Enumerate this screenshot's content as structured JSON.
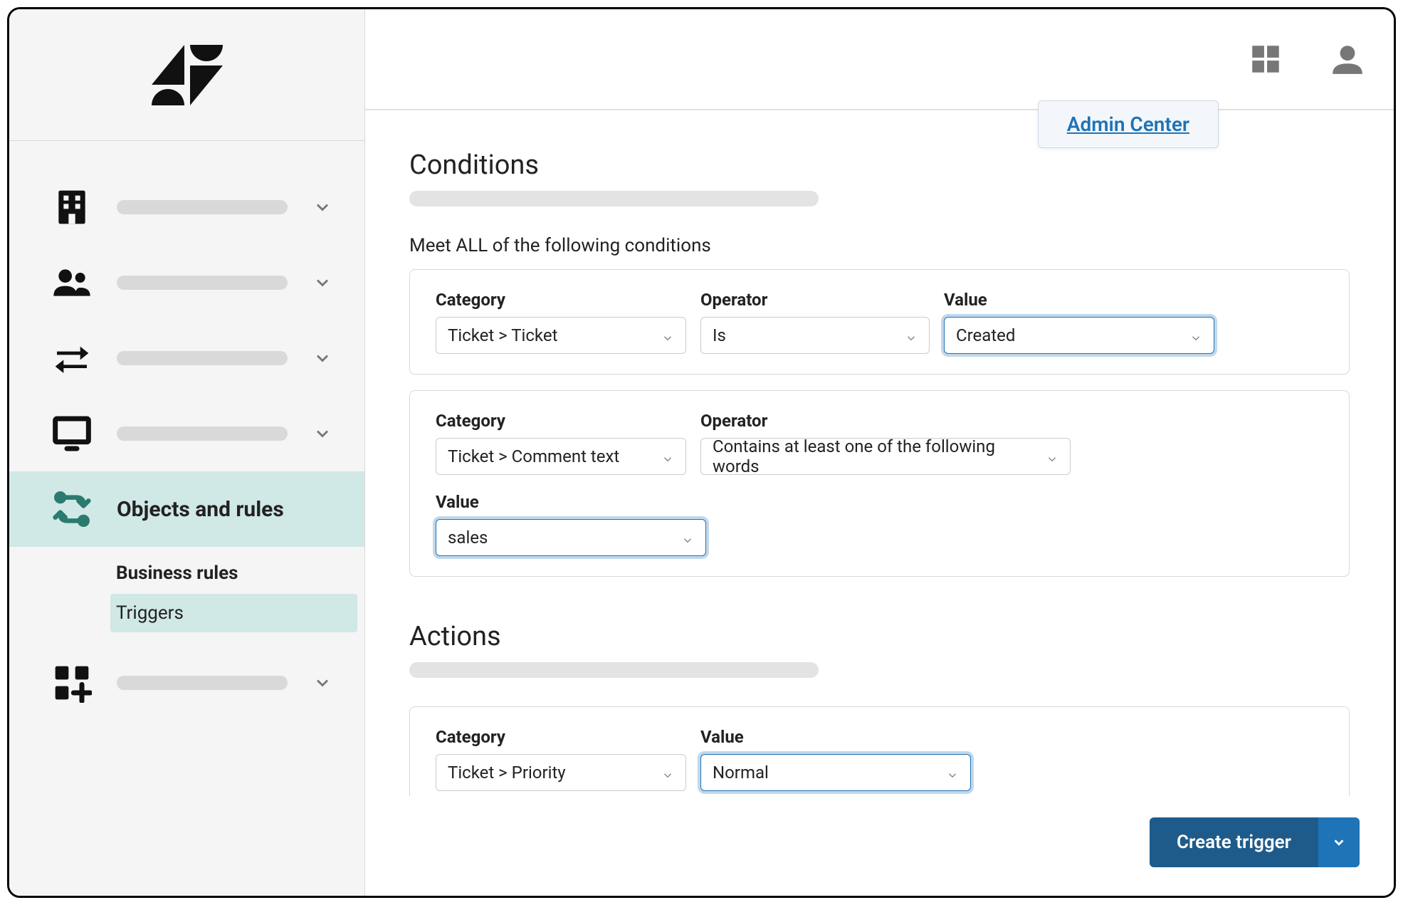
{
  "header": {
    "admin_link": "Admin Center"
  },
  "sidebar": {
    "active_label": "Objects and rules",
    "sub_header": "Business rules",
    "sub_item": "Triggers"
  },
  "conditions": {
    "title": "Conditions",
    "meet_all_label": "Meet ALL of the following conditions",
    "labels": {
      "category": "Category",
      "operator": "Operator",
      "value": "Value"
    },
    "row1": {
      "category": "Ticket > Ticket",
      "operator": "Is",
      "value": "Created"
    },
    "row2": {
      "category": "Ticket > Comment text",
      "operator": "Contains at least one of the following words",
      "value": "sales"
    }
  },
  "actions": {
    "title": "Actions",
    "labels": {
      "category": "Category",
      "value": "Value"
    },
    "row1": {
      "category": "Ticket > Priority",
      "value": "Normal"
    }
  },
  "footer": {
    "create_label": "Create trigger"
  }
}
